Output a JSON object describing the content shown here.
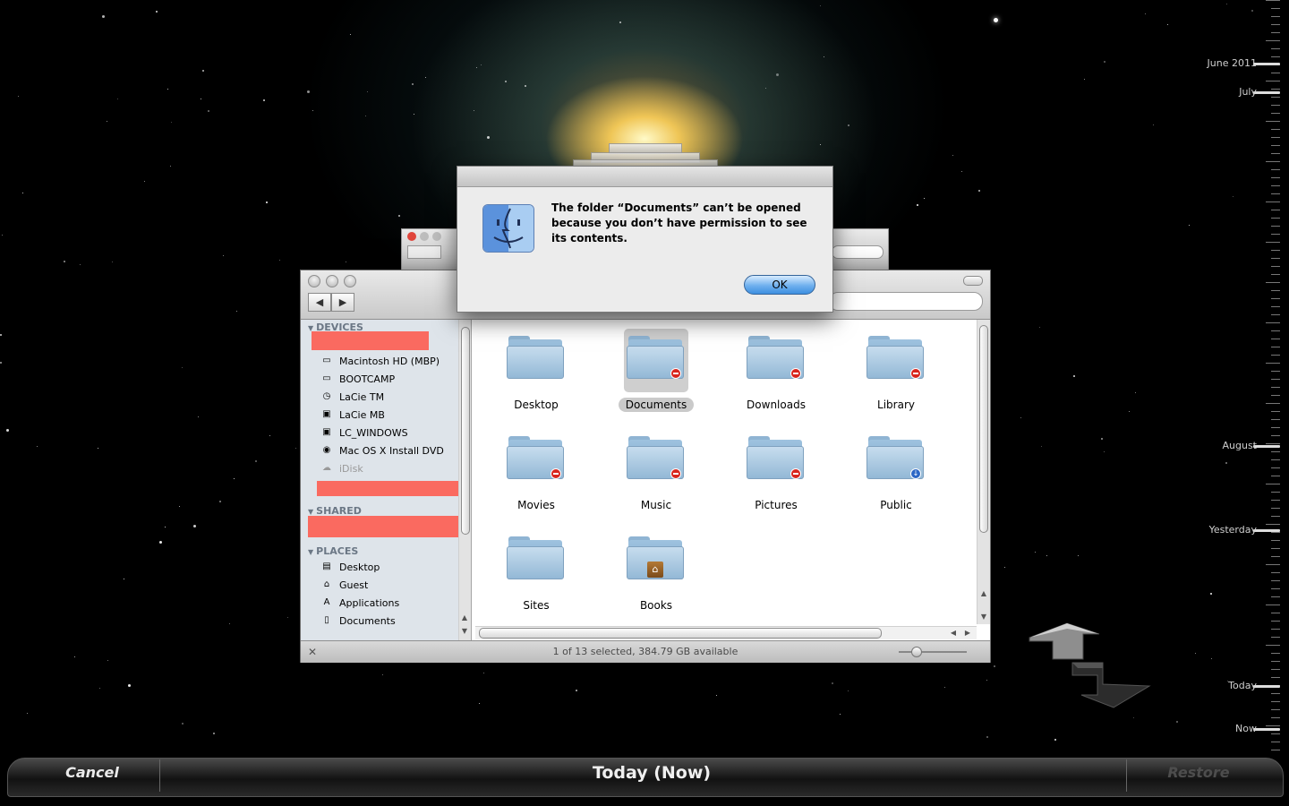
{
  "timeline": {
    "labels": [
      "June 2011",
      "July",
      "August",
      "Yesterday",
      "Today",
      "Now"
    ]
  },
  "alert": {
    "message": "The folder “Documents” can’t be opened because you don’t have permission to see its contents.",
    "ok_label": "OK"
  },
  "finder": {
    "sidebar": {
      "devices_header": "DEVICES",
      "devices": [
        {
          "label": "Macintosh HD (MBP)",
          "icon": "hard-drive-icon"
        },
        {
          "label": "BOOTCAMP",
          "icon": "hard-drive-icon"
        },
        {
          "label": "LaCie TM",
          "icon": "time-machine-drive-icon"
        },
        {
          "label": "LaCie MB",
          "icon": "external-drive-icon"
        },
        {
          "label": "LC_WINDOWS",
          "icon": "external-drive-icon"
        },
        {
          "label": "Mac OS X Install DVD",
          "icon": "dvd-icon"
        },
        {
          "label": "iDisk",
          "icon": "idisk-icon"
        }
      ],
      "shared_header": "SHARED",
      "places_header": "PLACES",
      "places": [
        {
          "label": "Desktop",
          "icon": "desktop-icon"
        },
        {
          "label": "Guest",
          "icon": "home-icon"
        },
        {
          "label": "Applications",
          "icon": "applications-icon"
        },
        {
          "label": "Documents",
          "icon": "document-icon"
        }
      ]
    },
    "items": [
      {
        "label": "Desktop",
        "badge": "none",
        "selected": false
      },
      {
        "label": "Documents",
        "badge": "no-access",
        "selected": true
      },
      {
        "label": "Downloads",
        "badge": "no-access",
        "selected": false
      },
      {
        "label": "Library",
        "badge": "no-access",
        "selected": false
      },
      {
        "label": "Movies",
        "badge": "no-access",
        "selected": false
      },
      {
        "label": "Music",
        "badge": "no-access",
        "selected": false
      },
      {
        "label": "Pictures",
        "badge": "no-access",
        "selected": false
      },
      {
        "label": "Public",
        "badge": "drop-box",
        "selected": false
      },
      {
        "label": "Sites",
        "badge": "none",
        "selected": false
      },
      {
        "label": "Books",
        "badge": "home",
        "selected": false
      }
    ],
    "status": "1 of 13 selected, 384.79 GB available"
  },
  "bottom_bar": {
    "cancel_label": "Cancel",
    "title": "Today (Now)",
    "restore_label": "Restore"
  },
  "colors": {
    "redaction": "#fa6a60",
    "ok_button": "#6fb0ee",
    "no_access_badge": "#d8261f"
  }
}
